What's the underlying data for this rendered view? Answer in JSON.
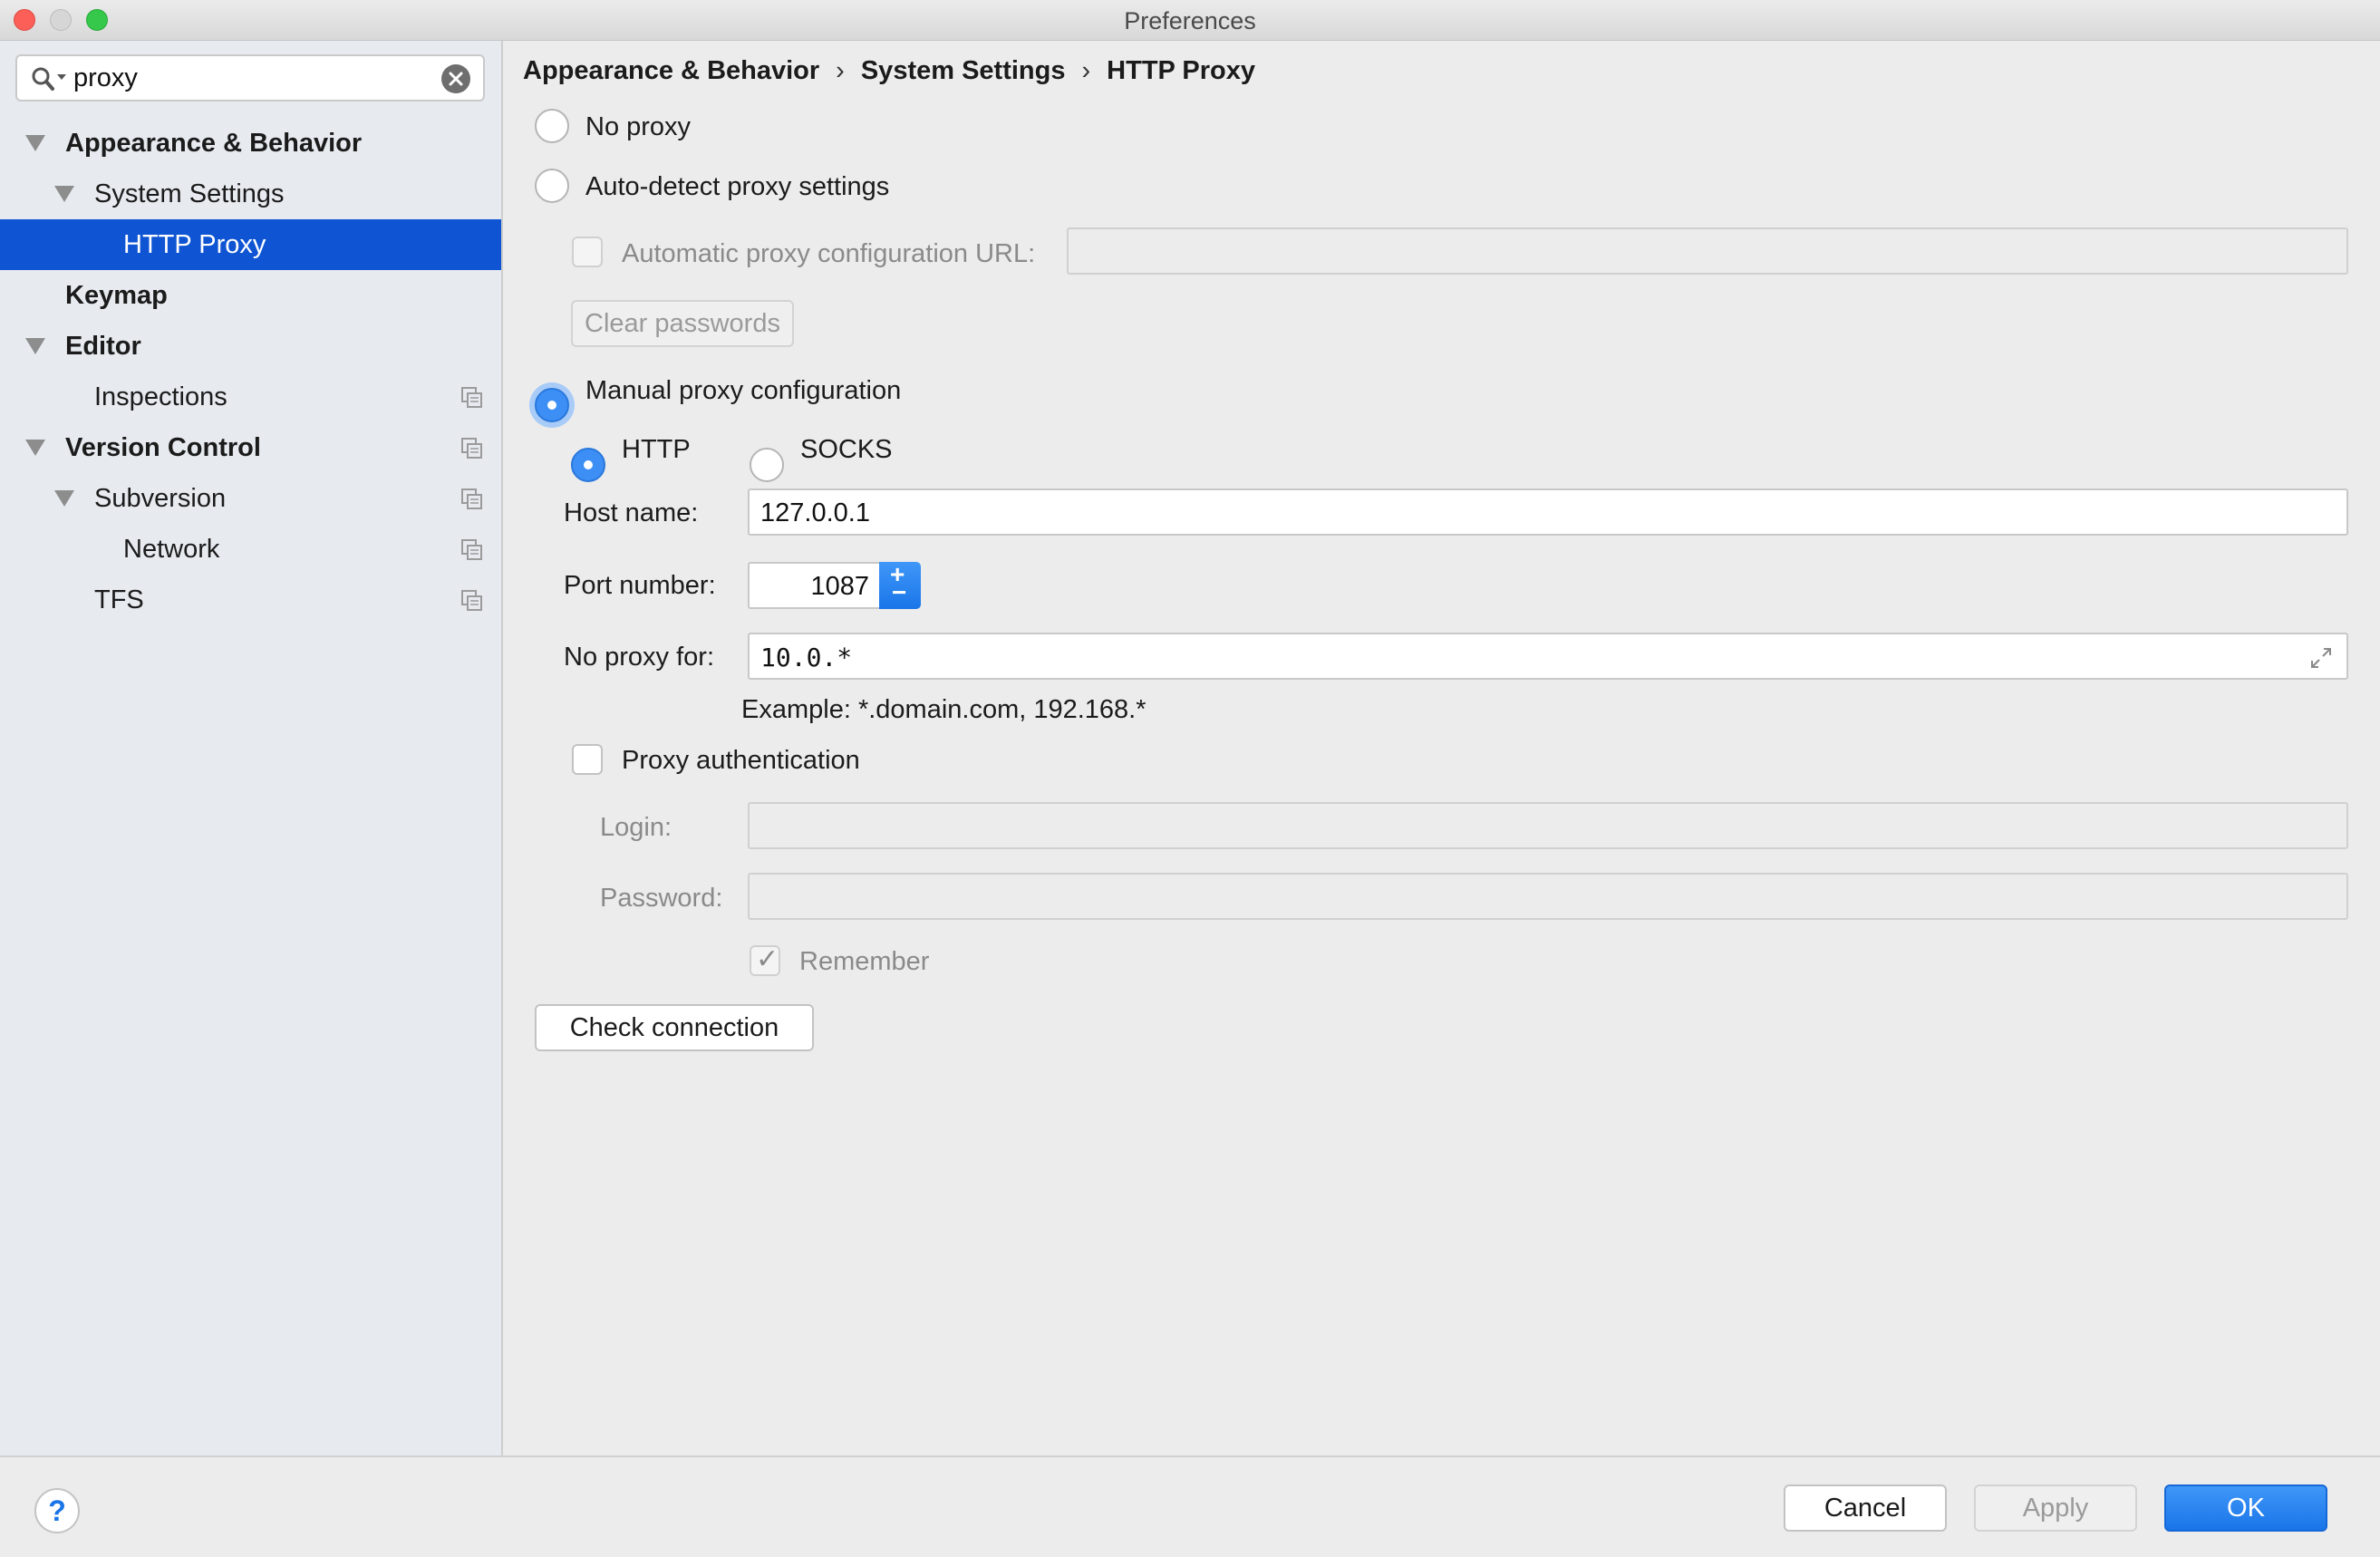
{
  "window": {
    "title": "Preferences"
  },
  "search": {
    "value": "proxy"
  },
  "sidebar": {
    "items": [
      {
        "label": "Appearance & Behavior"
      },
      {
        "label": "System Settings"
      },
      {
        "label": "HTTP Proxy"
      },
      {
        "label": "Keymap"
      },
      {
        "label": "Editor"
      },
      {
        "label": "Inspections"
      },
      {
        "label": "Version Control"
      },
      {
        "label": "Subversion"
      },
      {
        "label": "Network"
      },
      {
        "label": "TFS"
      }
    ]
  },
  "breadcrumb": [
    "Appearance & Behavior",
    "System Settings",
    "HTTP Proxy"
  ],
  "breadcrumb_separator": "›",
  "proxy": {
    "no_proxy_label": "No proxy",
    "auto_detect_label": "Auto-detect proxy settings",
    "auto_config_url_label": "Automatic proxy configuration URL:",
    "auto_config_url_value": "",
    "clear_passwords_label": "Clear passwords",
    "manual_label": "Manual proxy configuration",
    "selected_mode": "manual",
    "http_label": "HTTP",
    "socks_label": "SOCKS",
    "selected_protocol": "http",
    "host_label": "Host name:",
    "host_value": "127.0.0.1",
    "port_label": "Port number:",
    "port_value": "1087",
    "no_proxy_for_label": "No proxy for:",
    "no_proxy_for_value": "10.0.*",
    "example_text": "Example: *.domain.com, 192.168.*",
    "auth_label": "Proxy authentication",
    "auth_checked": false,
    "login_label": "Login:",
    "login_value": "",
    "password_label": "Password:",
    "password_value": "",
    "remember_label": "Remember",
    "remember_checked": true,
    "check_connection_label": "Check connection"
  },
  "footer": {
    "help_label": "?",
    "cancel_label": "Cancel",
    "apply_label": "Apply",
    "ok_label": "OK"
  },
  "colors": {
    "selection": "#0e54d3",
    "accent": "#1a75e8"
  },
  "icons": {
    "search": "search-icon",
    "clear": "clear-search-icon",
    "copy": "project-level-icon",
    "expand": "expand-icon",
    "tree_toggle": "triangle-down-icon"
  }
}
